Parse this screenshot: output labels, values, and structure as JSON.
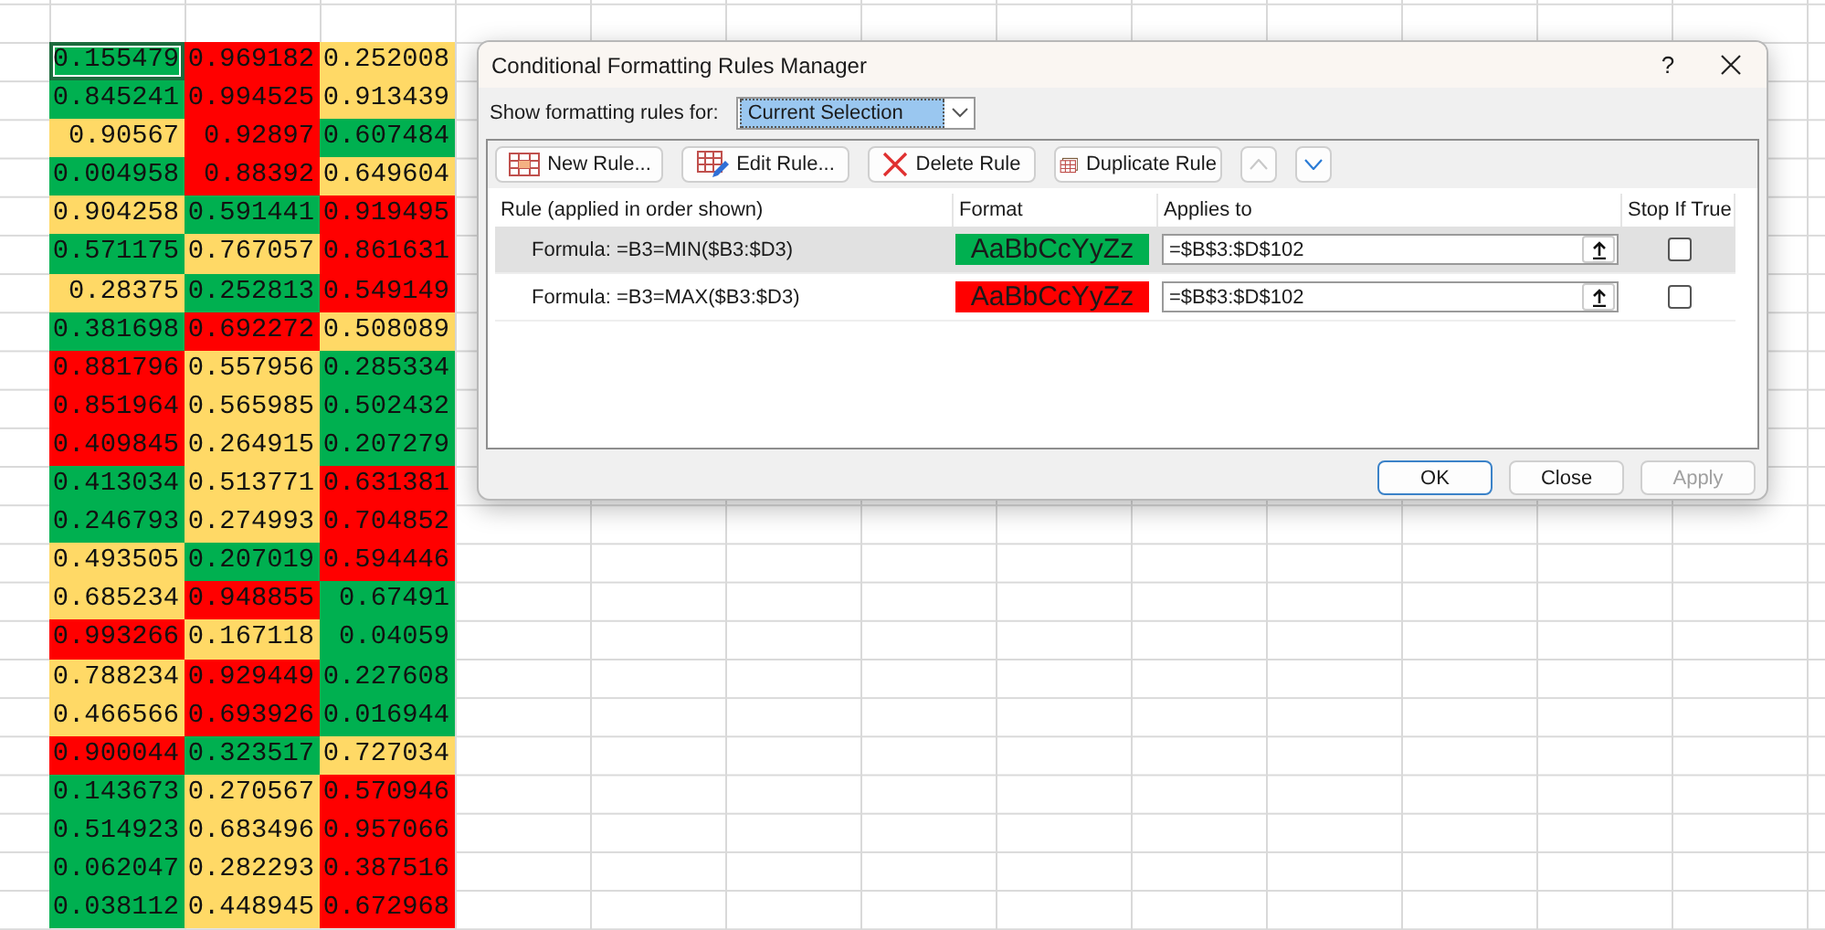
{
  "sheet": {
    "rows": [
      {
        "cells": [
          {
            "value": "0.155479",
            "color": "#00b050",
            "selected": true
          },
          {
            "value": "0.969182",
            "color": "#ff0000",
            "selected": false
          },
          {
            "value": "0.252008",
            "color": "#ffd966",
            "selected": false
          }
        ]
      },
      {
        "cells": [
          {
            "value": "0.845241",
            "color": "#00b050",
            "selected": false
          },
          {
            "value": "0.994525",
            "color": "#ff0000",
            "selected": false
          },
          {
            "value": "0.913439",
            "color": "#ffd966",
            "selected": false
          }
        ]
      },
      {
        "cells": [
          {
            "value": "0.90567",
            "color": "#ffd966",
            "selected": false
          },
          {
            "value": "0.92897",
            "color": "#ff0000",
            "selected": false
          },
          {
            "value": "0.607484",
            "color": "#00b050",
            "selected": false
          }
        ]
      },
      {
        "cells": [
          {
            "value": "0.004958",
            "color": "#00b050",
            "selected": false
          },
          {
            "value": "0.88392",
            "color": "#ff0000",
            "selected": false
          },
          {
            "value": "0.649604",
            "color": "#ffd966",
            "selected": false
          }
        ]
      },
      {
        "cells": [
          {
            "value": "0.904258",
            "color": "#ffd966",
            "selected": false
          },
          {
            "value": "0.591441",
            "color": "#00b050",
            "selected": false
          },
          {
            "value": "0.919495",
            "color": "#ff0000",
            "selected": false
          }
        ]
      },
      {
        "cells": [
          {
            "value": "0.571175",
            "color": "#00b050",
            "selected": false
          },
          {
            "value": "0.767057",
            "color": "#ffd966",
            "selected": false
          },
          {
            "value": "0.861631",
            "color": "#ff0000",
            "selected": false
          }
        ]
      },
      {
        "cells": [
          {
            "value": "0.28375",
            "color": "#ffd966",
            "selected": false
          },
          {
            "value": "0.252813",
            "color": "#00b050",
            "selected": false
          },
          {
            "value": "0.549149",
            "color": "#ff0000",
            "selected": false
          }
        ]
      },
      {
        "cells": [
          {
            "value": "0.381698",
            "color": "#00b050",
            "selected": false
          },
          {
            "value": "0.692272",
            "color": "#ff0000",
            "selected": false
          },
          {
            "value": "0.508089",
            "color": "#ffd966",
            "selected": false
          }
        ]
      },
      {
        "cells": [
          {
            "value": "0.881796",
            "color": "#ff0000",
            "selected": false
          },
          {
            "value": "0.557956",
            "color": "#ffd966",
            "selected": false
          },
          {
            "value": "0.285334",
            "color": "#00b050",
            "selected": false
          }
        ]
      },
      {
        "cells": [
          {
            "value": "0.851964",
            "color": "#ff0000",
            "selected": false
          },
          {
            "value": "0.565985",
            "color": "#ffd966",
            "selected": false
          },
          {
            "value": "0.502432",
            "color": "#00b050",
            "selected": false
          }
        ]
      },
      {
        "cells": [
          {
            "value": "0.409845",
            "color": "#ff0000",
            "selected": false
          },
          {
            "value": "0.264915",
            "color": "#ffd966",
            "selected": false
          },
          {
            "value": "0.207279",
            "color": "#00b050",
            "selected": false
          }
        ]
      },
      {
        "cells": [
          {
            "value": "0.413034",
            "color": "#00b050",
            "selected": false
          },
          {
            "value": "0.513771",
            "color": "#ffd966",
            "selected": false
          },
          {
            "value": "0.631381",
            "color": "#ff0000",
            "selected": false
          }
        ]
      },
      {
        "cells": [
          {
            "value": "0.246793",
            "color": "#00b050",
            "selected": false
          },
          {
            "value": "0.274993",
            "color": "#ffd966",
            "selected": false
          },
          {
            "value": "0.704852",
            "color": "#ff0000",
            "selected": false
          }
        ]
      },
      {
        "cells": [
          {
            "value": "0.493505",
            "color": "#ffd966",
            "selected": false
          },
          {
            "value": "0.207019",
            "color": "#00b050",
            "selected": false
          },
          {
            "value": "0.594446",
            "color": "#ff0000",
            "selected": false
          }
        ]
      },
      {
        "cells": [
          {
            "value": "0.685234",
            "color": "#ffd966",
            "selected": false
          },
          {
            "value": "0.948855",
            "color": "#ff0000",
            "selected": false
          },
          {
            "value": "0.67491",
            "color": "#00b050",
            "selected": false
          }
        ]
      },
      {
        "cells": [
          {
            "value": "0.993266",
            "color": "#ff0000",
            "selected": false
          },
          {
            "value": "0.167118",
            "color": "#ffd966",
            "selected": false
          },
          {
            "value": "0.04059",
            "color": "#00b050",
            "selected": false
          }
        ]
      },
      {
        "cells": [
          {
            "value": "0.788234",
            "color": "#ffd966",
            "selected": false
          },
          {
            "value": "0.929449",
            "color": "#ff0000",
            "selected": false
          },
          {
            "value": "0.227608",
            "color": "#00b050",
            "selected": false
          }
        ]
      },
      {
        "cells": [
          {
            "value": "0.466566",
            "color": "#ffd966",
            "selected": false
          },
          {
            "value": "0.693926",
            "color": "#ff0000",
            "selected": false
          },
          {
            "value": "0.016944",
            "color": "#00b050",
            "selected": false
          }
        ]
      },
      {
        "cells": [
          {
            "value": "0.900044",
            "color": "#ff0000",
            "selected": false
          },
          {
            "value": "0.323517",
            "color": "#00b050",
            "selected": false
          },
          {
            "value": "0.727034",
            "color": "#ffd966",
            "selected": false
          }
        ]
      },
      {
        "cells": [
          {
            "value": "0.143673",
            "color": "#00b050",
            "selected": false
          },
          {
            "value": "0.270567",
            "color": "#ffd966",
            "selected": false
          },
          {
            "value": "0.570946",
            "color": "#ff0000",
            "selected": false
          }
        ]
      },
      {
        "cells": [
          {
            "value": "0.514923",
            "color": "#00b050",
            "selected": false
          },
          {
            "value": "0.683496",
            "color": "#ffd966",
            "selected": false
          },
          {
            "value": "0.957066",
            "color": "#ff0000",
            "selected": false
          }
        ]
      },
      {
        "cells": [
          {
            "value": "0.062047",
            "color": "#00b050",
            "selected": false
          },
          {
            "value": "0.282293",
            "color": "#ffd966",
            "selected": false
          },
          {
            "value": "0.387516",
            "color": "#ff0000",
            "selected": false
          }
        ]
      },
      {
        "cells": [
          {
            "value": "0.038112",
            "color": "#00b050",
            "selected": false
          },
          {
            "value": "0.448945",
            "color": "#ffd966",
            "selected": false
          },
          {
            "value": "0.672968",
            "color": "#ff0000",
            "selected": false
          }
        ]
      }
    ]
  },
  "dialog": {
    "title": "Conditional Formatting Rules Manager",
    "help": "?",
    "show_rules_for": {
      "label": "Show formatting rules for:",
      "value": "Current Selection"
    },
    "toolbar": [
      {
        "kind": "button",
        "label": "New Rule...",
        "disabled": false
      },
      {
        "kind": "button",
        "label": "Edit Rule...",
        "disabled": false
      },
      {
        "kind": "button",
        "label": "Delete Rule",
        "disabled": false
      },
      {
        "kind": "button",
        "label": "Duplicate Rule",
        "disabled": false
      },
      {
        "kind": "up",
        "disabled": true
      },
      {
        "kind": "down",
        "disabled": false
      }
    ],
    "columns": [
      "Rule (applied in order shown)",
      "Format",
      "Applies to",
      "Stop If True"
    ],
    "rules": [
      {
        "rule": "Formula: =B3=MIN($B3:$D3)",
        "preview": "AaBbCcYyZz",
        "color": "#00b050",
        "applies_to": "=$B$3:$D$102",
        "stop_if_true": false,
        "selected": true
      },
      {
        "rule": "Formula: =B3=MAX($B3:$D3)",
        "preview": "AaBbCcYyZz",
        "color": "#ff0000",
        "applies_to": "=$B$3:$D$102",
        "stop_if_true": false,
        "selected": false
      }
    ],
    "buttons": [
      {
        "label": "OK",
        "default": true,
        "disabled": false
      },
      {
        "label": "Close",
        "default": false,
        "disabled": false
      },
      {
        "label": "Apply",
        "default": false,
        "disabled": true
      }
    ]
  }
}
